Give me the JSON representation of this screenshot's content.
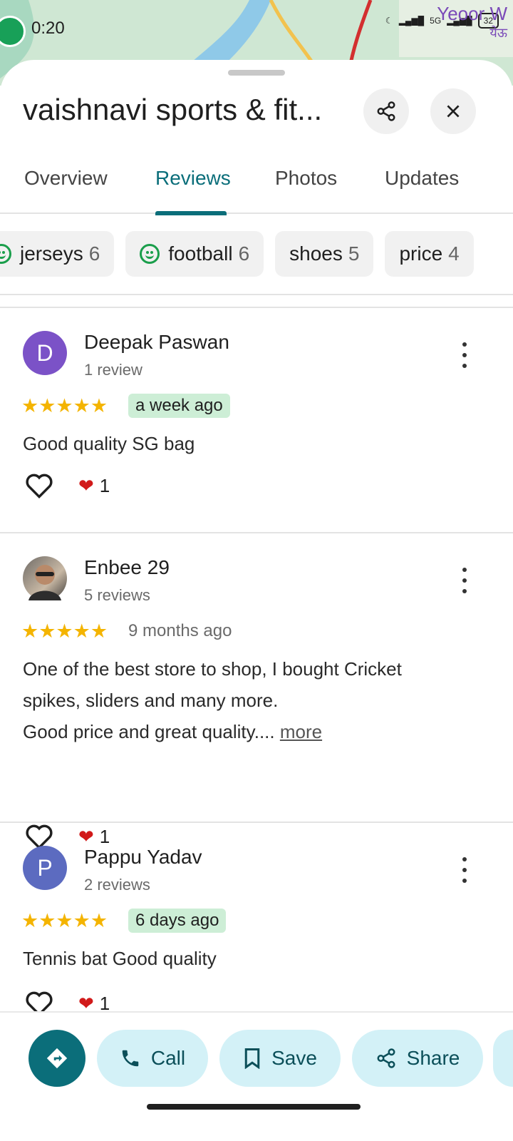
{
  "status_bar": {
    "time": "0:20",
    "network": "5G",
    "battery": "32",
    "map_label": "Yeoor W",
    "map_label_local": "येऊ"
  },
  "place": {
    "title": "vaishnavi sports & fit..."
  },
  "tabs": [
    {
      "label": "Overview",
      "active": false
    },
    {
      "label": "Reviews",
      "active": true
    },
    {
      "label": "Photos",
      "active": false
    },
    {
      "label": "Updates",
      "active": false
    }
  ],
  "topic_chips": [
    {
      "label": "jerseys",
      "count": "6",
      "positive": true
    },
    {
      "label": "football",
      "count": "6",
      "positive": true
    },
    {
      "label": "shoes",
      "count": "5",
      "positive": false
    },
    {
      "label": "price",
      "count": "4",
      "positive": false
    }
  ],
  "reviews": [
    {
      "avatar_letter": "D",
      "avatar_color": "#7b52c7",
      "name": "Deepak Paswan",
      "review_count": "1 review",
      "rating": 5,
      "stars": "★★★★★",
      "time": "a week ago",
      "time_is_new": true,
      "text": "Good quality SG bag",
      "more": "",
      "reactions": "1"
    },
    {
      "avatar_letter": "",
      "avatar_color": "",
      "name": "Enbee 29",
      "review_count": "5 reviews",
      "rating": 5,
      "stars": "★★★★★",
      "time": "9 months ago",
      "time_is_new": false,
      "text_lines": [
        "One of the best store to shop, I bought Cricket",
        "spikes, sliders and many more.",
        "Good price and great quality.... "
      ],
      "more": "more",
      "reactions": "1"
    },
    {
      "avatar_letter": "P",
      "avatar_color": "#5c6bc0",
      "name": "Pappu Yadav",
      "review_count": "2 reviews",
      "rating": 5,
      "stars": "★★★★★",
      "time": "6 days ago",
      "time_is_new": true,
      "text": "Tennis bat Good quality",
      "more": "",
      "reactions": "1"
    }
  ],
  "actions": {
    "directions_icon": "directions-icon",
    "call": "Call",
    "save": "Save",
    "share": "Share"
  },
  "colors": {
    "accent": "#0b6e7a",
    "pill_bg": "#d3f1f7",
    "star": "#f4b400",
    "new_badge": "#cdeed6"
  }
}
